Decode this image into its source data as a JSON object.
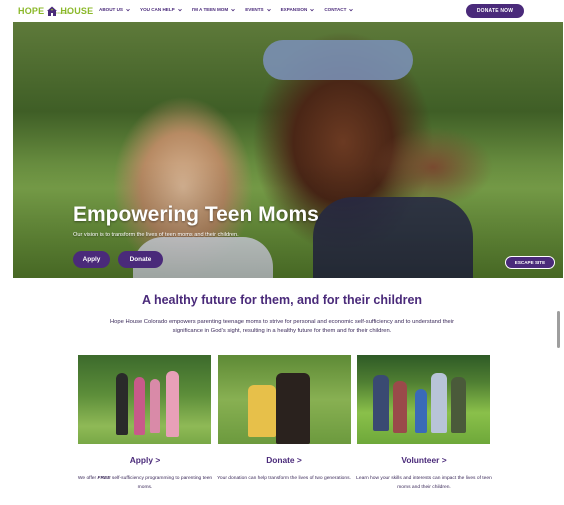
{
  "header": {
    "logo_left": "HOPE",
    "logo_right": "HOUSE",
    "logo_tagline": "COLORADO",
    "nav": [
      {
        "label": "ABOUT US"
      },
      {
        "label": "YOU CAN HELP"
      },
      {
        "label": "I'M A TEEN MOM"
      },
      {
        "label": "EVENTS"
      },
      {
        "label": "EXPANSION"
      },
      {
        "label": "CONTACT"
      }
    ],
    "donate_label": "DONATE NOW"
  },
  "hero": {
    "title": "Empowering Teen Moms",
    "subtitle": "Our vision is to transform the lives of teen moms and their children.",
    "apply_label": "Apply",
    "donate_label": "Donate",
    "escape_label": "ESCAPE SITE"
  },
  "mission": {
    "title": "A healthy future for them, and for their children",
    "text": "Hope House Colorado empowers parenting teenage moms to strive for personal and economic self-sufficiency and to understand their significance in God’s sight, resulting in a healthy future for them and for their children."
  },
  "cards": [
    {
      "title": "Apply >",
      "text_pre": "We offer ",
      "text_emph": "FREE",
      "text_post": " self-sufficiency programming to parenting teen moms."
    },
    {
      "title": "Donate >",
      "text": "Your donation can help transform the lives of two generations."
    },
    {
      "title": "Volunteer >",
      "text": "Learn how your skills and interests can impact the lives of teen moms and their children."
    }
  ],
  "colors": {
    "brand_purple": "#4a2a7a",
    "brand_green": "#8bb82a"
  },
  "icons": [
    "house-icon",
    "chevron-down-icon"
  ]
}
